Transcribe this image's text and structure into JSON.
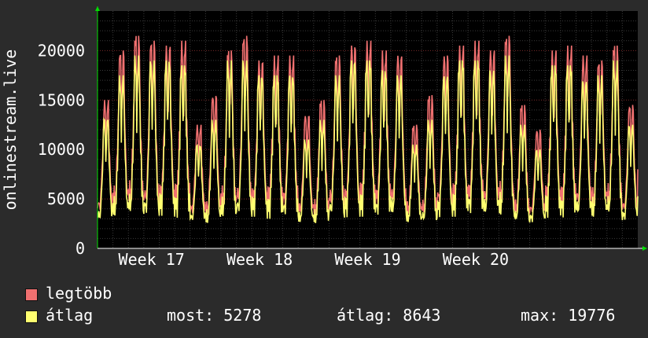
{
  "chart_data": {
    "type": "line",
    "ylabel": "onlinestream.live",
    "ylim": [
      0,
      24000
    ],
    "yticks": [
      0,
      5000,
      10000,
      15000,
      20000
    ],
    "xticks": [
      "Week 17",
      "Week 18",
      "Week 19",
      "Week 20"
    ],
    "grid": true,
    "colors": {
      "background": "#2b2b2b",
      "plot": "#000000",
      "grid_major": "#7a2a2a",
      "grid_minor": "#3a3a3a",
      "axis": "#00e000"
    },
    "days": 35,
    "series": [
      {
        "name": "legtöbb",
        "color": "#f07070",
        "daily_peaks": [
          15000,
          20000,
          21500,
          21000,
          20500,
          21000,
          12500,
          15500,
          20000,
          21500,
          19000,
          19500,
          19500,
          13500,
          15000,
          19500,
          20500,
          21000,
          20000,
          19500,
          12500,
          15500,
          19500,
          20500,
          21000,
          20000,
          21500,
          14500,
          12000,
          20000,
          20500,
          19500,
          19000,
          20500,
          14500
        ],
        "daily_mins": [
          3500,
          4000,
          4200,
          4000,
          4300,
          4100,
          3300,
          3000,
          3800,
          4000,
          4200,
          4000,
          3900,
          3200,
          3100,
          3900,
          4100,
          4200,
          4000,
          4100,
          3300,
          3200,
          4000,
          4200,
          4300,
          4000,
          4100,
          3300,
          3300,
          4100,
          4000,
          4000,
          3900,
          4100,
          3400
        ],
        "last": 8000
      },
      {
        "name": "átlag",
        "color": "#ffff70",
        "daily_peaks": [
          13200,
          17500,
          19500,
          19000,
          19000,
          18500,
          10500,
          13000,
          19000,
          19000,
          17500,
          17500,
          17500,
          11000,
          13000,
          17500,
          19000,
          19000,
          18000,
          17500,
          10500,
          13000,
          17500,
          19000,
          19000,
          18000,
          19500,
          12500,
          10000,
          18500,
          18500,
          17000,
          17500,
          19000,
          12500
        ],
        "daily_mins": [
          2500,
          3000,
          3200,
          3000,
          3300,
          3100,
          2500,
          2300,
          2800,
          3000,
          3200,
          3000,
          2900,
          2400,
          2300,
          2900,
          3100,
          3200,
          3000,
          3100,
          2500,
          2400,
          3000,
          3200,
          3300,
          3000,
          3100,
          2500,
          2500,
          3100,
          3000,
          3000,
          2900,
          3100,
          2600
        ],
        "last": 5278
      }
    ]
  },
  "legend": {
    "max_label": "legtöbb",
    "avg_label": "átlag",
    "now_text": "most: 5278",
    "avg_text": "átlag: 8643",
    "max_text": "max: 19776"
  }
}
